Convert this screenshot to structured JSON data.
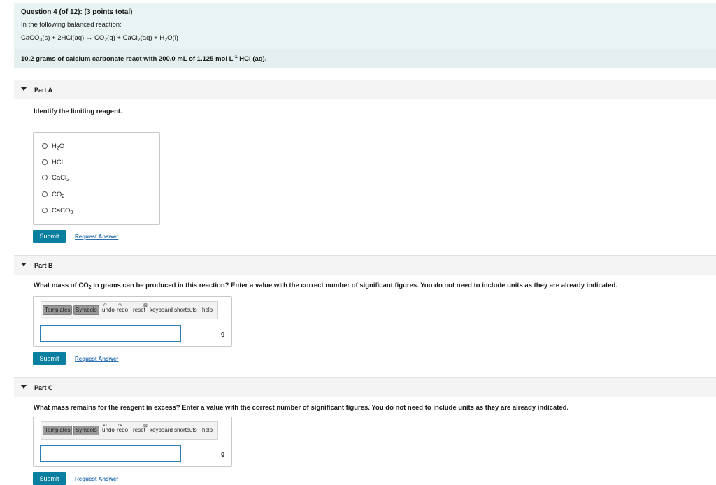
{
  "question": {
    "title": "Question 4 (of 12): (3 points total)",
    "intro": "In the following balanced reaction:",
    "reaction": [
      {
        "t": "CaCO"
      },
      {
        "s": "3"
      },
      {
        "t": "(s) + 2HCl(aq) → CO"
      },
      {
        "s": "2"
      },
      {
        "t": "(g) + CaCl"
      },
      {
        "s": "2"
      },
      {
        "t": "(aq) + H"
      },
      {
        "s": "2"
      },
      {
        "t": "O(l)"
      }
    ],
    "given": [
      {
        "t": "10.2 grams of calcium carbonate react with 200.0 mL of 1.125 mol L"
      },
      {
        "p": "-1"
      },
      {
        "t": " HCl (aq)."
      }
    ]
  },
  "parts": {
    "a": {
      "label": "Part A",
      "prompt": "Identify the limiting reagent.",
      "options": [
        [
          {
            "t": "H"
          },
          {
            "s": "2"
          },
          {
            "t": "O"
          }
        ],
        [
          {
            "t": "HCl"
          }
        ],
        [
          {
            "t": "CaCl"
          },
          {
            "s": "2"
          }
        ],
        [
          {
            "t": "CO"
          },
          {
            "s": "2"
          }
        ],
        [
          {
            "t": "CaCO"
          },
          {
            "s": "3"
          }
        ]
      ],
      "submit": "Submit",
      "request": "Request Answer"
    },
    "b": {
      "label": "Part B",
      "prompt": [
        {
          "t": "What mass of CO"
        },
        {
          "s": "2"
        },
        {
          "t": " in grams can be produced in this reaction? Enter a value with the correct number of significant figures. You do not need to include units as they are already indicated."
        }
      ],
      "unit": "g",
      "submit": "Submit",
      "request": "Request Answer"
    },
    "c": {
      "label": "Part C",
      "prompt": "What mass remains for the reagent in excess? Enter a value with the correct number of significant figures. You do not need to include units as they are already indicated.",
      "unit": "g",
      "submit": "Submit",
      "request": "Request Answer"
    }
  },
  "toolbar": {
    "templates": "Templates",
    "symbols": "Symbols",
    "undo": "undo",
    "redo": "redo",
    "reset": "reset",
    "shortcuts": "keyboard shortcuts",
    "help": "help"
  },
  "icons": {
    "expand": "triangle-down-icon",
    "radio": "radio-circle-icon",
    "undo": "undo-arrow-icon",
    "redo": "redo-arrow-icon",
    "reset": "reset-icon",
    "keyboard": "keyboard-icon"
  },
  "colors": {
    "intro_bg": "#eaf3f3",
    "submit_bg": "#0a7fa0",
    "link": "#2a6fb0"
  }
}
